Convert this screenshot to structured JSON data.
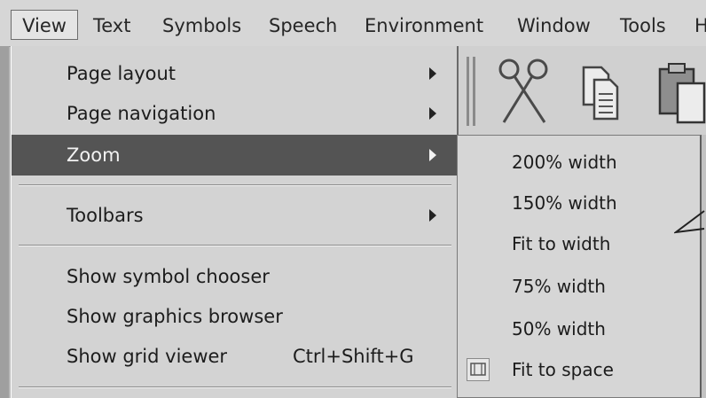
{
  "menubar": {
    "items": [
      "View",
      "Text",
      "Symbols",
      "Speech",
      "Environment",
      "Window",
      "Tools",
      "H"
    ]
  },
  "view_menu": {
    "items": [
      {
        "label": "Page layout",
        "has_submenu": true
      },
      {
        "label": "Page navigation",
        "has_submenu": true
      },
      {
        "label": "Zoom",
        "has_submenu": true,
        "selected": true
      },
      {
        "label": "Toolbars",
        "has_submenu": true
      },
      {
        "label": "Show symbol chooser"
      },
      {
        "label": "Show graphics browser"
      },
      {
        "label": "Show grid viewer",
        "shortcut": "Ctrl+Shift+G"
      }
    ]
  },
  "zoom_submenu": {
    "items": [
      "200% width",
      "150% width",
      "Fit to width",
      "75% width",
      "50% width",
      "Fit to space"
    ]
  },
  "toolbar": {
    "icons": [
      "scissors-icon",
      "copy-icon",
      "paste-icon"
    ]
  },
  "colors": {
    "selected_bg": "#545454",
    "menu_bg": "#d3d3d3"
  }
}
